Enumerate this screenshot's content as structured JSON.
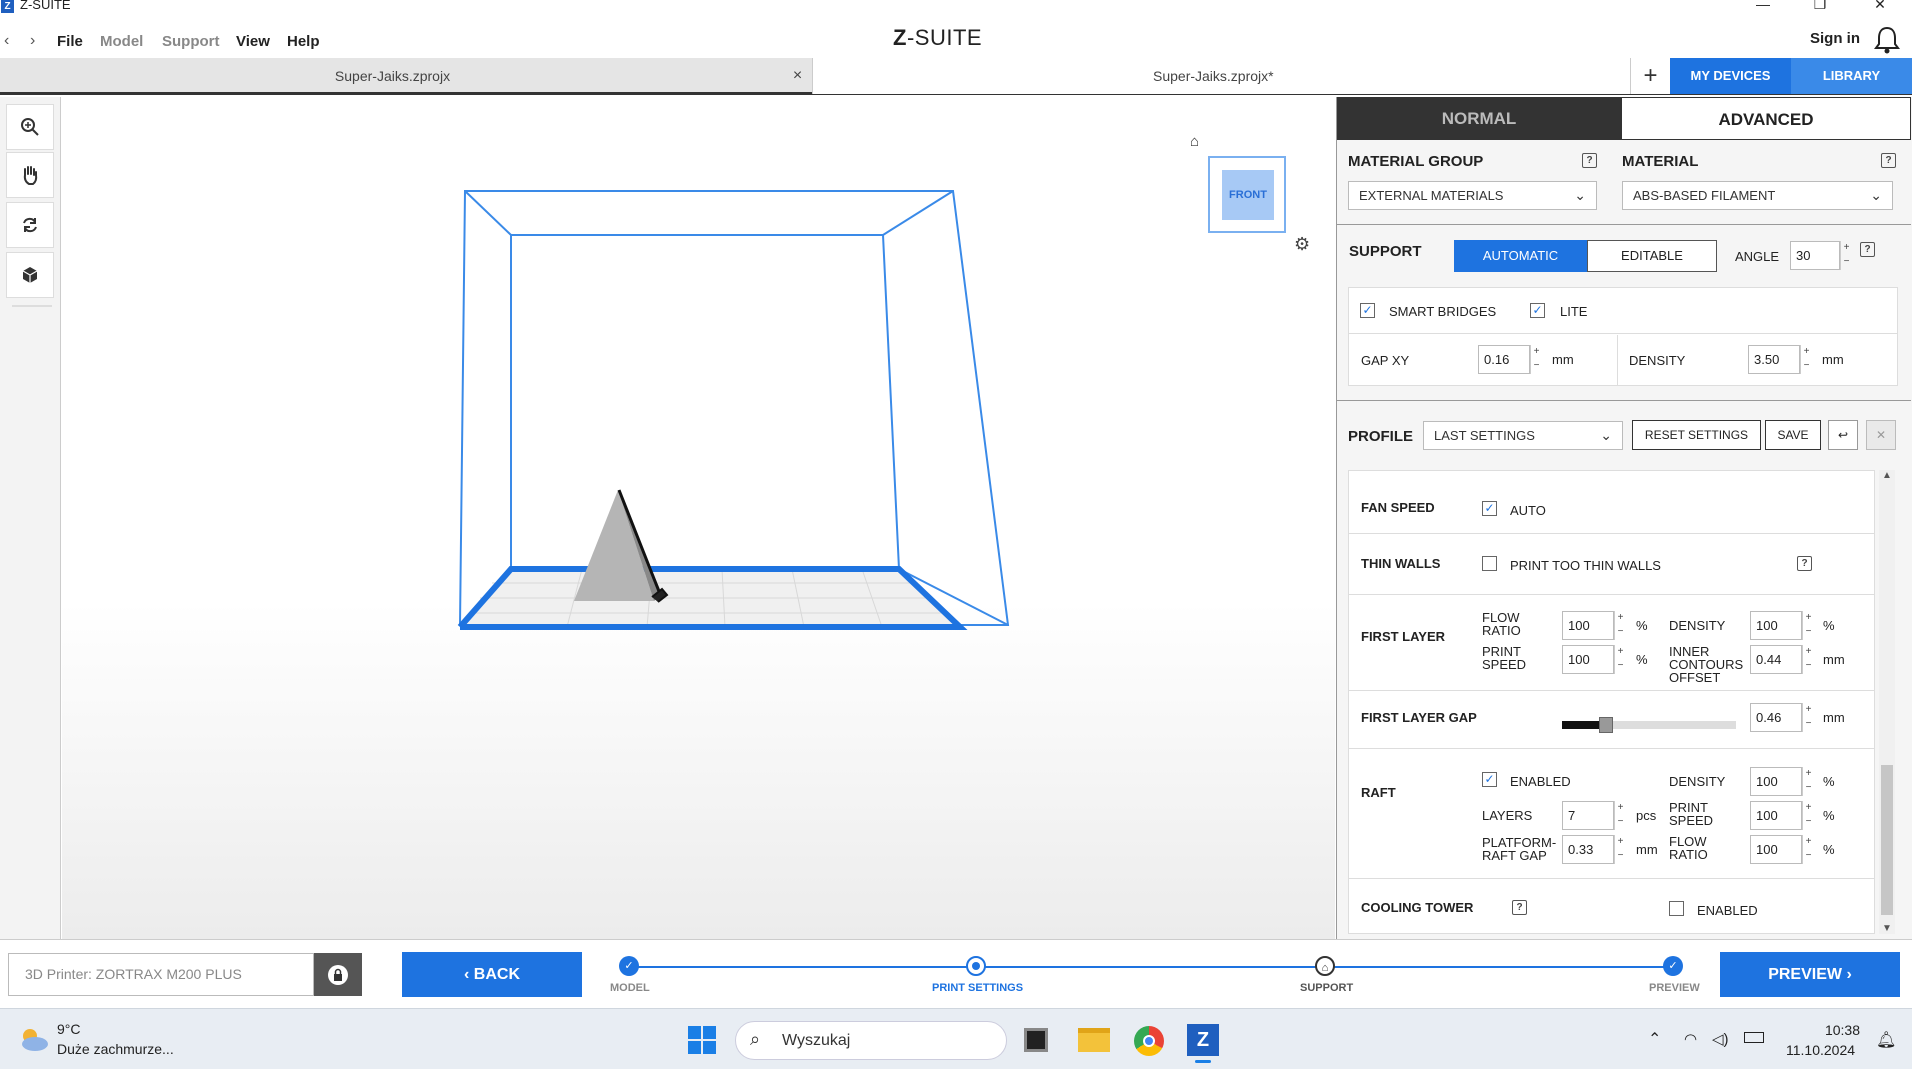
{
  "window": {
    "title": "Z-SUITE",
    "icon_text": "Z",
    "controls": [
      "minimize-icon",
      "restore-icon",
      "close-icon"
    ]
  },
  "menu": {
    "items": [
      "File",
      "Model",
      "Support",
      "View",
      "Help"
    ],
    "logo_a": "Z",
    "logo_b": "-SUITE",
    "sign_in": "Sign in"
  },
  "tabs": [
    {
      "label": "Super-Jaiks.zprojx",
      "close": "×"
    },
    {
      "label": "Super-Jaiks.zprojx*",
      "close": "×"
    }
  ],
  "top_buttons": {
    "add": "+",
    "devices": "MY DEVICES",
    "library": "LIBRARY"
  },
  "toolbar": [
    "zoom-icon",
    "pan-icon",
    "rotate-icon",
    "cube-icon"
  ],
  "viewcube": {
    "face": "FRONT"
  },
  "panel": {
    "mode_tabs": {
      "normal": "NORMAL",
      "advanced": "ADVANCED"
    },
    "material_group": {
      "label": "MATERIAL GROUP",
      "value": "EXTERNAL MATERIALS"
    },
    "material": {
      "label": "MATERIAL",
      "value": "ABS-BASED FILAMENT"
    },
    "support": {
      "label": "SUPPORT",
      "automatic": "AUTOMATIC",
      "editable": "EDITABLE",
      "angle_label": "ANGLE",
      "angle": "30",
      "smart_bridges": "SMART BRIDGES",
      "lite": "LITE",
      "gap_xy_label": "GAP XY",
      "gap_xy": "0.16",
      "gap_unit": "mm",
      "density_label": "DENSITY",
      "density": "3.50",
      "density_unit": "mm"
    },
    "profile": {
      "label": "PROFILE",
      "value": "LAST SETTINGS",
      "reset": "RESET SETTINGS",
      "save": "SAVE"
    },
    "fan_speed": {
      "label": "FAN SPEED",
      "auto": "AUTO"
    },
    "thin_walls": {
      "label": "THIN WALLS",
      "option": "PRINT TOO THIN WALLS"
    },
    "first_layer": {
      "label": "FIRST LAYER",
      "flow_ratio_a": "FLOW",
      "flow_ratio_b": "RATIO",
      "flow_ratio": "100",
      "print_speed_a": "PRINT",
      "print_speed_b": "SPEED",
      "print_speed": "100",
      "density_label": "DENSITY",
      "density": "100",
      "inner_a": "INNER",
      "inner_b": "CONTOURS",
      "inner_c": "OFFSET",
      "inner": "0.44",
      "pct": "%",
      "mm": "mm"
    },
    "first_layer_gap": {
      "label": "FIRST LAYER GAP",
      "value": "0.46",
      "unit": "mm",
      "slider_fraction": 0.25
    },
    "raft": {
      "label": "RAFT",
      "enabled": "ENABLED",
      "layers_label": "LAYERS",
      "layers": "7",
      "layers_unit": "pcs",
      "gap_a": "PLATFORM-",
      "gap_b": "RAFT GAP",
      "gap": "0.33",
      "gap_unit": "mm",
      "density_label": "DENSITY",
      "density": "100",
      "speed_a": "PRINT",
      "speed_b": "SPEED",
      "speed": "100",
      "flow_a": "FLOW",
      "flow_b": "RATIO",
      "flow": "100",
      "pct": "%"
    },
    "cooling_tower": {
      "label": "COOLING TOWER",
      "enabled": "ENABLED"
    }
  },
  "bottom": {
    "printer": "3D Printer: ZORTRAX M200 PLUS",
    "back": "BACK",
    "steps": [
      "MODEL",
      "PRINT SETTINGS",
      "SUPPORT",
      "PREVIEW"
    ],
    "preview": "PREVIEW"
  },
  "taskbar": {
    "temp": "9°C",
    "weather": "Duże zachmurze...",
    "search": "Wyszukaj",
    "time": "10:38",
    "date": "11.10.2024"
  },
  "colors": {
    "accent": "#1e73e0",
    "dark": "#333333"
  }
}
